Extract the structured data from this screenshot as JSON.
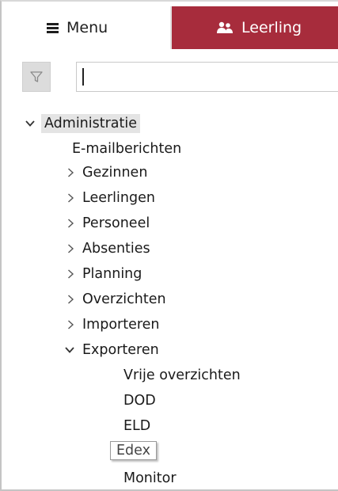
{
  "tabs": {
    "menu_label": "Menu",
    "leerling_label": "Leerling"
  },
  "search": {
    "placeholder": "",
    "value": ""
  },
  "tree": {
    "root": "Administratie",
    "items": [
      {
        "label": "E-mailberichten",
        "expander": "none"
      },
      {
        "label": "Gezinnen",
        "expander": "collapsed"
      },
      {
        "label": "Leerlingen",
        "expander": "collapsed"
      },
      {
        "label": "Personeel",
        "expander": "collapsed"
      },
      {
        "label": "Absenties",
        "expander": "collapsed"
      },
      {
        "label": "Planning",
        "expander": "collapsed"
      },
      {
        "label": "Overzichten",
        "expander": "collapsed"
      },
      {
        "label": "Importeren",
        "expander": "collapsed"
      },
      {
        "label": "Exporteren",
        "expander": "expanded"
      }
    ],
    "export_children": [
      "Vrije overzichten",
      "DOD",
      "ELD",
      "Edex",
      "Monitor"
    ]
  },
  "colors": {
    "accent_tab": "#a72c3c",
    "root_highlight": "#e4e4e4",
    "filter_button": "#dcdcdc"
  },
  "icons": [
    "hamburger-icon",
    "people-icon",
    "filter-icon",
    "chevron-down-icon",
    "chevron-right-icon"
  ]
}
